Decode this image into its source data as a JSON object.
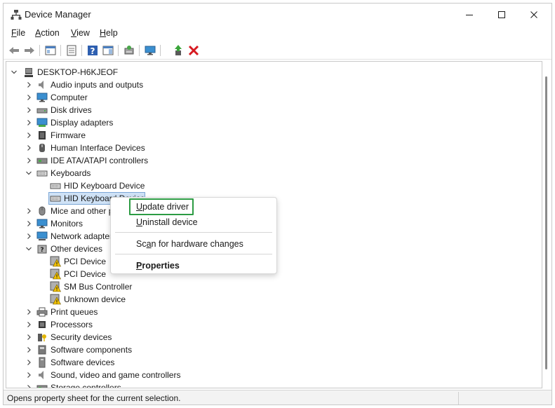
{
  "window": {
    "title": "Device Manager"
  },
  "menu": {
    "file": {
      "mnemonic": "F",
      "rest": "ile"
    },
    "action": {
      "mnemonic": "A",
      "rest": "ction"
    },
    "view": {
      "mnemonic": "V",
      "rest": "iew"
    },
    "help": {
      "mnemonic": "H",
      "rest": "elp"
    }
  },
  "tree": {
    "root": "DESKTOP-H6KJEOF",
    "items": {
      "audio": "Audio inputs and outputs",
      "computer": "Computer",
      "disk": "Disk drives",
      "display": "Display adapters",
      "firmware": "Firmware",
      "hid": "Human Interface Devices",
      "ide": "IDE ATA/ATAPI controllers",
      "keyboards": "Keyboards",
      "keyboard_device_1": "HID Keyboard Device",
      "keyboard_device_2": "HID Keyboard Device",
      "mice": "Mice and other pointing devices",
      "monitors": "Monitors",
      "network": "Network adapters",
      "other": "Other devices",
      "pci_1": "PCI Device",
      "pci_2": "PCI Device",
      "smbus": "SM Bus Controller",
      "unknown": "Unknown device",
      "print": "Print queues",
      "processors": "Processors",
      "security": "Security devices",
      "sw_components": "Software components",
      "sw_devices": "Software devices",
      "sound": "Sound, video and game controllers",
      "storage": "Storage controllers"
    }
  },
  "context_menu": {
    "update": {
      "mnemonic": "U",
      "rest": "pdate driver"
    },
    "uninstall": {
      "mnemonic": "U",
      "rest": "ninstall device"
    },
    "scan": {
      "pre": "Sc",
      "mnemonic": "a",
      "rest": "n for hardware changes"
    },
    "properties": {
      "mnemonic": "P",
      "rest": "roperties"
    }
  },
  "status": {
    "text": "Opens property sheet for the current selection."
  },
  "colors": {
    "highlight_border": "#2c9b43",
    "selection_fill": "#cfe2f6",
    "error_red": "#d71920"
  }
}
